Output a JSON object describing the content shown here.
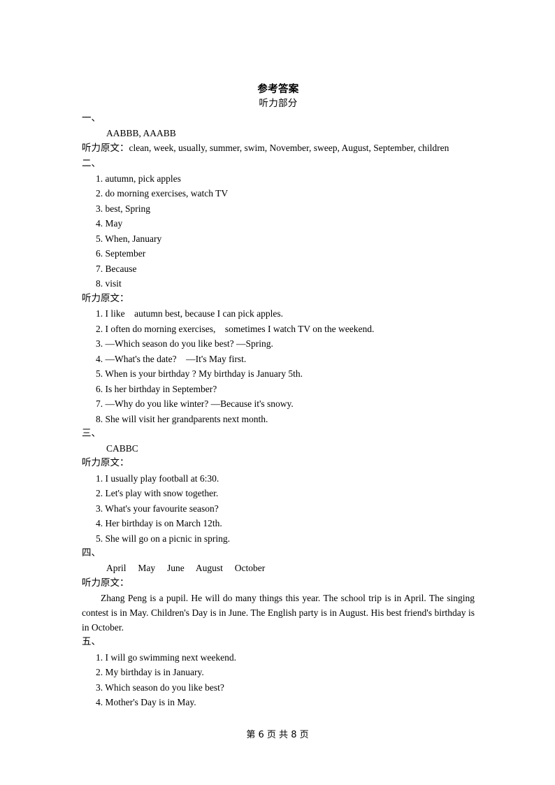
{
  "document": {
    "title_main": "参考答案",
    "title_sub": "听力部分",
    "transcript_label": "听力原文：",
    "transcript_label_inline": "听力原文："
  },
  "sections": [
    {
      "marker": "一、",
      "answer": "AABBB, AAABB",
      "transcript_inline": "clean, week, usually, summer, swim, November, sweep, August, September, children"
    },
    {
      "marker": "二、",
      "answers": [
        "1. autumn, pick apples",
        "2. do morning exercises, watch TV",
        "3. best, Spring",
        "4. May",
        "5. When, January",
        "6. September",
        "7. Because",
        "8. visit"
      ],
      "transcript": [
        "1. I like    autumn best, because I can pick apples.",
        "2. I often do morning exercises,    sometimes I watch TV on the weekend.",
        "3. —Which season do you like best? —Spring.",
        "4. —What's the date?    —It's May first.",
        "5. When is your birthday ? My birthday is January 5th.",
        "6. Is her birthday in September?",
        "7. —Why do you like winter? —Because it's snowy.",
        "8. She will visit her grandparents next month."
      ]
    },
    {
      "marker": "三、",
      "answer": "CABBC",
      "transcript": [
        "1. I usually play football at 6:30.",
        "2. Let's play with snow together.",
        "3. What's your favourite season?",
        "4. Her birthday is on March 12th.",
        "5. She will go on a picnic in spring."
      ]
    },
    {
      "marker": "四、",
      "answer": "April     May     June     August     October",
      "paragraph": "Zhang Peng is a pupil. He will do many things this year. The school trip is in April. The singing contest is in May. Children's Day is in June. The English party is in August. His best friend's birthday is in October."
    },
    {
      "marker": "五、",
      "answers": [
        "1. I will go swimming next weekend.",
        "2. My birthday is in January.",
        "3. Which season do you like best?",
        "4. Mother's Day is in May."
      ]
    }
  ],
  "footer": {
    "page_label": "第 6 页 共 8 页"
  }
}
